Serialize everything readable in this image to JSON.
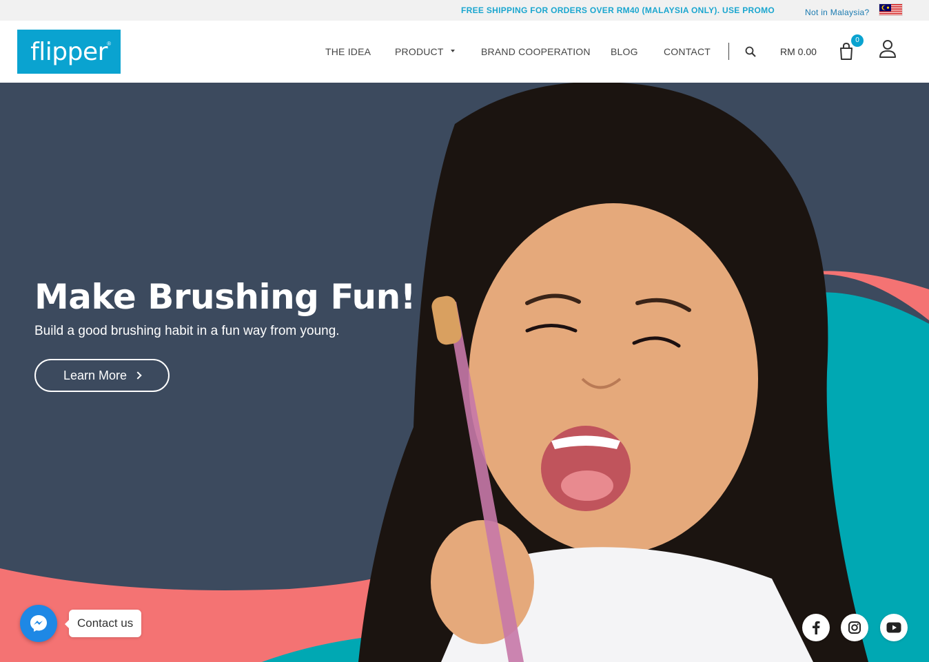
{
  "topbar": {
    "promo": "FREE SHIPPING FOR ORDERS OVER RM40 (MALAYSIA ONLY). USE PROMO",
    "region_link": "Not in Malaysia?",
    "flag_icon": "malaysia-flag-icon"
  },
  "header": {
    "logo_text": "flipper",
    "logo_mark": "®",
    "nav": [
      {
        "label": "THE IDEA"
      },
      {
        "label": "PRODUCT"
      },
      {
        "label": "BRAND COOPERATION"
      },
      {
        "label": "BLOG"
      },
      {
        "label": "CONTACT"
      }
    ],
    "cart_total": "RM 0.00",
    "cart_count": "0"
  },
  "hero": {
    "title": "Make Brushing Fun!",
    "subtitle": "Build a good brushing habit in a fun way from young.",
    "cta_label": "Learn More",
    "image_description_icon": "girl-with-toothbrush-photo"
  },
  "chat": {
    "label": "Contact us",
    "icon": "messenger-icon"
  },
  "social": [
    "facebook-icon",
    "instagram-icon",
    "youtube-icon"
  ],
  "colors": {
    "brand": "#0aa3d0",
    "hero_bg": "#3c4a5e",
    "coral": "#f47373",
    "teal": "#00a8b3"
  }
}
